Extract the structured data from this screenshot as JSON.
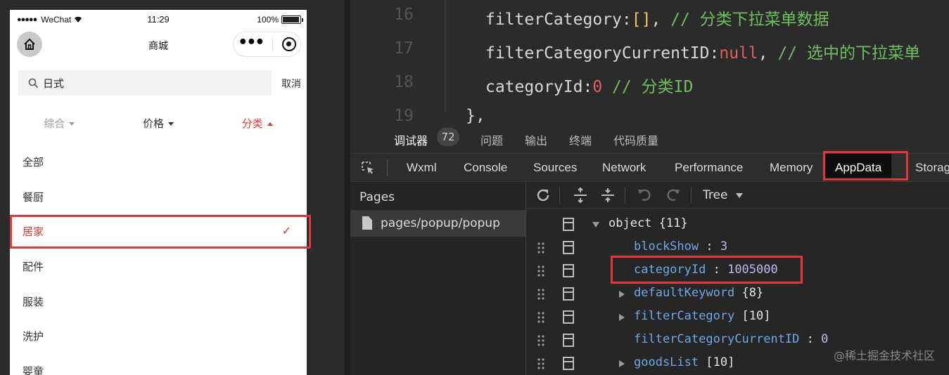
{
  "phone": {
    "status": {
      "signal": "●●●●●",
      "carrier": "WeChat",
      "time": "11:29",
      "battery": "100%"
    },
    "nav_title": "商城",
    "capsule_more": "•••",
    "search": {
      "query": "日式",
      "cancel": "取消"
    },
    "sort": [
      {
        "label": "综合",
        "color": "#999999",
        "arrow": "down"
      },
      {
        "label": "价格",
        "color": "#333333",
        "arrow": "down"
      },
      {
        "label": "分类",
        "color": "#e0373a",
        "arrow": "up"
      }
    ],
    "categories": [
      {
        "label": "全部",
        "selected": false
      },
      {
        "label": "餐厨",
        "selected": false
      },
      {
        "label": "居家",
        "selected": true
      },
      {
        "label": "配件",
        "selected": false
      },
      {
        "label": "服装",
        "selected": false
      },
      {
        "label": "洗护",
        "selected": false
      },
      {
        "label": "婴童",
        "selected": false
      }
    ],
    "check": "✓"
  },
  "editor": {
    "lines": [
      {
        "num": "16",
        "prop": "filterCategory",
        "colon": ":",
        "value": "[]",
        "sep": ",",
        "comment": " // 分类下拉菜单数据"
      },
      {
        "num": "17",
        "prop": "filterCategoryCurrentID",
        "colon": ":",
        "value": "null",
        "sep": ",",
        "comment": " // 选中的下拉菜单"
      },
      {
        "num": "18",
        "prop": "categoryId",
        "colon": ":",
        "value": "0",
        "sep": "",
        "comment": " // 分类ID"
      },
      {
        "num": "19",
        "prop": "},",
        "colon": "",
        "value": "",
        "sep": "",
        "comment": ""
      }
    ]
  },
  "devtools": {
    "tabs": [
      "调试器",
      "问题",
      "输出",
      "终端",
      "代码质量"
    ],
    "active_tab": "调试器",
    "badge": "72",
    "panel_tabs": [
      "Wxml",
      "Console",
      "Sources",
      "Network",
      "Performance",
      "Memory",
      "AppData",
      "Storag"
    ],
    "active_panel": "AppData",
    "pages_title": "Pages",
    "page_path": "pages/popup/popup",
    "view_mode": "Tree",
    "tree": {
      "root": {
        "key": "object",
        "meta": "{11}"
      },
      "rows": [
        {
          "key": "blockShow",
          "value": "3",
          "expandable": false
        },
        {
          "key": "categoryId",
          "value": "1005000",
          "expandable": false
        },
        {
          "key": "defaultKeyword",
          "value": "{8}",
          "expandable": true
        },
        {
          "key": "filterCategory",
          "value": "[10]",
          "expandable": true
        },
        {
          "key": "filterCategoryCurrentID",
          "value": "0",
          "expandable": false
        },
        {
          "key": "goodsList",
          "value": "[10]",
          "expandable": true
        }
      ]
    }
  },
  "watermark": "@稀土掘金技术社区",
  "colors": {
    "accent": "#e0373a",
    "key": "#6fa9e6",
    "number": "#c7b5f0"
  }
}
